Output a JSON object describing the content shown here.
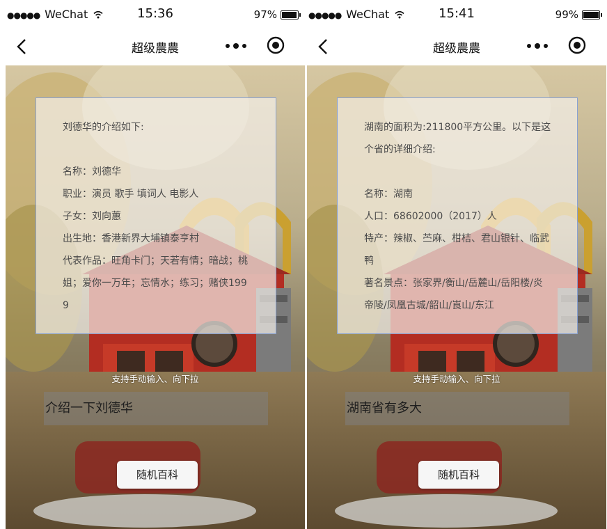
{
  "screens": [
    {
      "status": {
        "carrier": "WeChat",
        "time": "15:36",
        "battery": "97%",
        "battery_level": 0.97
      },
      "nav": {
        "title": "超级農農"
      },
      "answer_lines": [
        "刘德华的介绍如下:",
        "",
        "名称：刘德华",
        "职业：演员 歌手 填词人 电影人",
        "子女：刘向蕙",
        "出生地：香港新界大埔镇泰亨村",
        "代表作品：旺角卡门；天若有情；暗战；桃姐；爱你一万年；忘情水；练习；赌侠1999"
      ],
      "hint": "支持手动输入、向下拉",
      "query": "介绍一下刘德华",
      "random_button": "随机百科"
    },
    {
      "status": {
        "carrier": "WeChat",
        "time": "15:41",
        "battery": "99%",
        "battery_level": 0.99
      },
      "nav": {
        "title": "超级農農"
      },
      "answer_lines": [
        "湖南的面积为:211800平方公里。以下是这个省的详细介绍:",
        "",
        "名称：湖南",
        "人口：68602000（2017）人",
        "特产：辣椒、苎麻、柑桔、君山银针、临武鸭",
        "著名景点：张家界/衡山/岳麓山/岳阳楼/炎帝陵/凤凰古城/韶山/崀山/东江"
      ],
      "hint": "支持手动输入、向下拉",
      "query": "湖南省有多大",
      "random_button": "随机百科"
    }
  ],
  "colors": {
    "card_border": "#7896d2",
    "answer_text": "#4b4b4b",
    "input_bg": "#808080"
  }
}
